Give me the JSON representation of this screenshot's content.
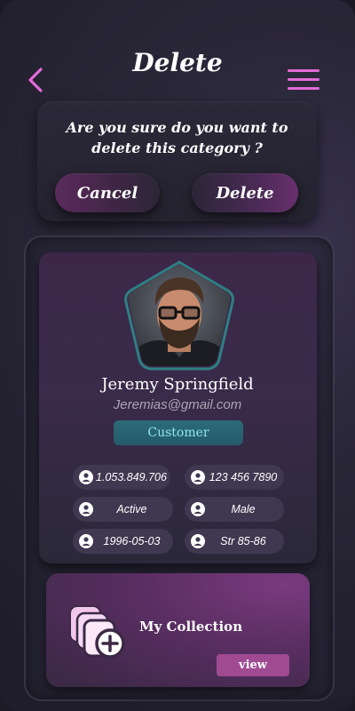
{
  "header": {
    "title": "Delete"
  },
  "dialog": {
    "message": "Are you sure do you want to delete this category ?",
    "cancel_label": "Cancel",
    "delete_label": "Delete"
  },
  "profile": {
    "name": "Jeremy Springfield",
    "email": "Jeremias@gmail.com",
    "role": "Customer",
    "details": {
      "id_number": "1.053.849.706",
      "phone": "123 456 7890",
      "status": "Active",
      "gender": "Male",
      "birth_date": "1996-05-03",
      "address": "Str 85-86"
    }
  },
  "collection": {
    "label": "My Collection",
    "view_label": "view"
  },
  "colors": {
    "accent": "#e46ad8",
    "badge_text": "#8ee6ec",
    "view_button": "#a04a92"
  }
}
